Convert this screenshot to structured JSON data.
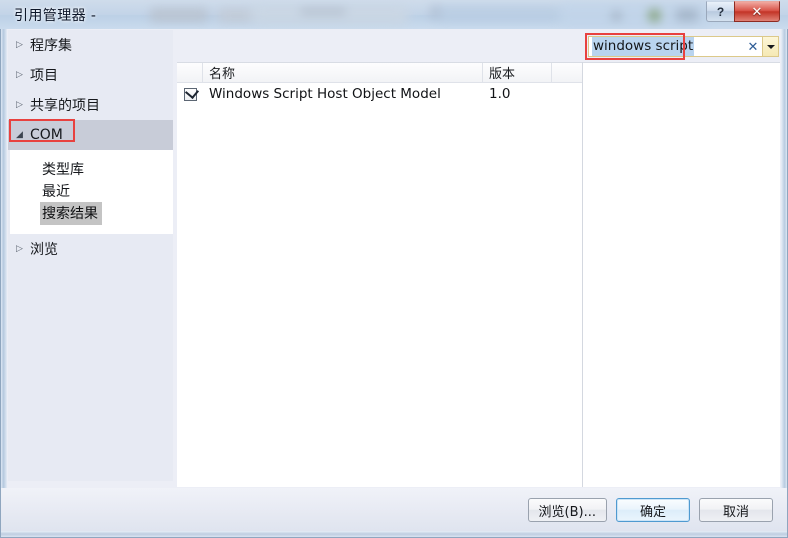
{
  "window": {
    "title": "引用管理器 -",
    "help_button": "?",
    "close_button": "✕"
  },
  "sidebar": {
    "nodes": [
      {
        "label": "程序集",
        "arrow": "▷",
        "expanded": false
      },
      {
        "label": "项目",
        "arrow": "▷",
        "expanded": false
      },
      {
        "label": "共享的项目",
        "arrow": "▷",
        "expanded": false
      },
      {
        "label": "COM",
        "arrow": "◢",
        "expanded": true
      },
      {
        "label": "浏览",
        "arrow": "▷",
        "expanded": false
      }
    ],
    "com_children": [
      {
        "label": "类型库",
        "active": false
      },
      {
        "label": "最近",
        "active": false
      },
      {
        "label": "搜索结果",
        "active": true
      }
    ]
  },
  "list": {
    "columns": [
      "",
      "名称",
      "版本",
      ""
    ],
    "rows": [
      {
        "checked": true,
        "name": "Windows Script Host Object Model",
        "version": "1.0"
      }
    ]
  },
  "search": {
    "value": "windows script",
    "clear_icon": "✕",
    "dropdown_icon": "▼"
  },
  "footer": {
    "browse_label": "浏览(B)...",
    "browse_prefix": "浏览(",
    "browse_mnemonic": "B",
    "browse_suffix": ")...",
    "ok_label": "确定",
    "cancel_label": "取消"
  },
  "colors": {
    "annotation": "#e8413f",
    "selection": "#c8ccd8",
    "sub_active": "#c4c4c4",
    "text_selection": "#b9d4ef",
    "close_button": "#c33427"
  }
}
